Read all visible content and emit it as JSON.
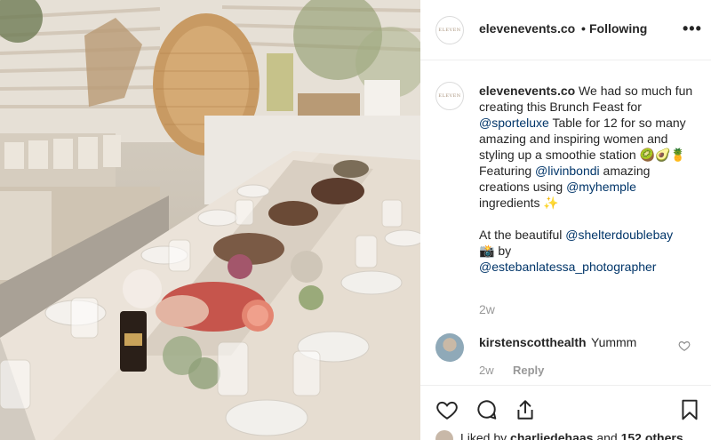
{
  "post": {
    "username": "elevenevents.co",
    "separator": "•",
    "follow_status": "Following",
    "more_icon": "more-horizontal-icon",
    "avatar_logo": "ELEVEN"
  },
  "caption": {
    "username": "elevenevents.co",
    "text_1": " We had so much fun creating this Brunch Feast for ",
    "mention_1": "@sporteluxe",
    "text_2": " Table for 12 for so many amazing and inspiring women and styling up a smoothie station 🥝🥑🍍",
    "text_3": "Featuring ",
    "mention_2": "@livinbondi",
    "text_4": " amazing creations using ",
    "mention_3": "@myhemple",
    "text_5": " ingredients ✨",
    "text_6": "At the beautiful ",
    "mention_4": "@shelterdoublebay",
    "text_7": "📸 by",
    "mention_5": "@estebanlatessa_photographer",
    "time": "2w"
  },
  "comment": {
    "username": "kirstenscotthealth",
    "text": "Yummm",
    "time": "2w",
    "reply_label": "Reply"
  },
  "actions": {
    "like_icon": "heart-icon",
    "comment_icon": "comment-icon",
    "share_icon": "share-icon",
    "save_icon": "bookmark-icon"
  },
  "likes": {
    "prefix": "Liked by ",
    "user": "charliedehaas",
    "middle": " and ",
    "count": "152 others"
  }
}
